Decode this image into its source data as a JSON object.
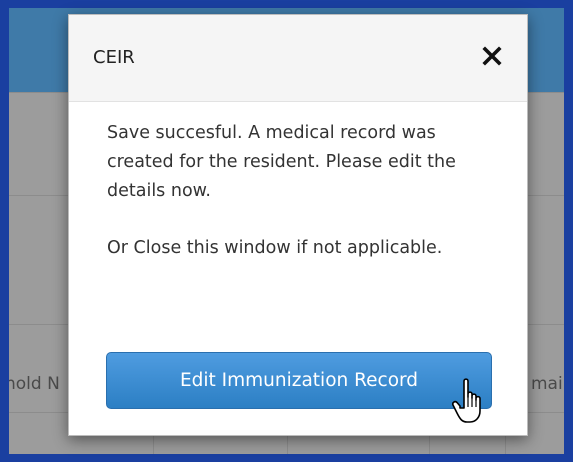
{
  "background": {
    "partial_column_left": "hold N",
    "partial_column_right": "mai"
  },
  "modal": {
    "title": "CEIR",
    "close_label": "×",
    "message_line_1": "Save succesful. A medical record was created for the resident. Please edit the details now.",
    "message_line_2": "Or Close this window if not applicable.",
    "primary_button_label": "Edit Immunization Record"
  },
  "icons": {
    "close": "close-icon",
    "cursor": "hand-pointer-icon"
  },
  "colors": {
    "outer_border": "#1a3fa0",
    "header_bar": "#3f7aa8",
    "button": "#2c7fc4",
    "button_text": "#ffffff"
  }
}
